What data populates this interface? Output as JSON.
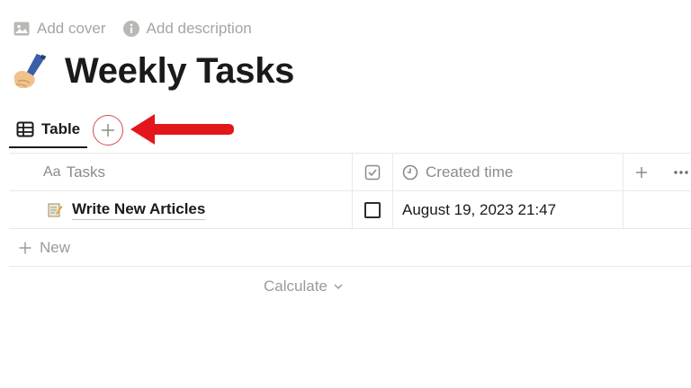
{
  "meta_actions": {
    "add_cover": "Add cover",
    "add_description": "Add description"
  },
  "page": {
    "title": "Weekly Tasks",
    "icon": "writing-hand-emoji"
  },
  "views": {
    "active_tab": "Table",
    "add_view_icon": "plus-icon"
  },
  "table": {
    "columns": [
      {
        "label": "Tasks",
        "prefix": "Aa",
        "icon": "text-property-icon"
      },
      {
        "label": "",
        "icon": "checkbox-property-icon"
      },
      {
        "label": "Created time",
        "icon": "clock-icon"
      }
    ],
    "rows": [
      {
        "name": "Write New Articles",
        "icon": "memo-emoji",
        "checked": false,
        "created": "August 19, 2023 21:47"
      }
    ],
    "new_label": "New",
    "calculate_label": "Calculate"
  },
  "annotation": {
    "arrow_color": "#e3161b",
    "circle_color": "#d94a4a"
  }
}
